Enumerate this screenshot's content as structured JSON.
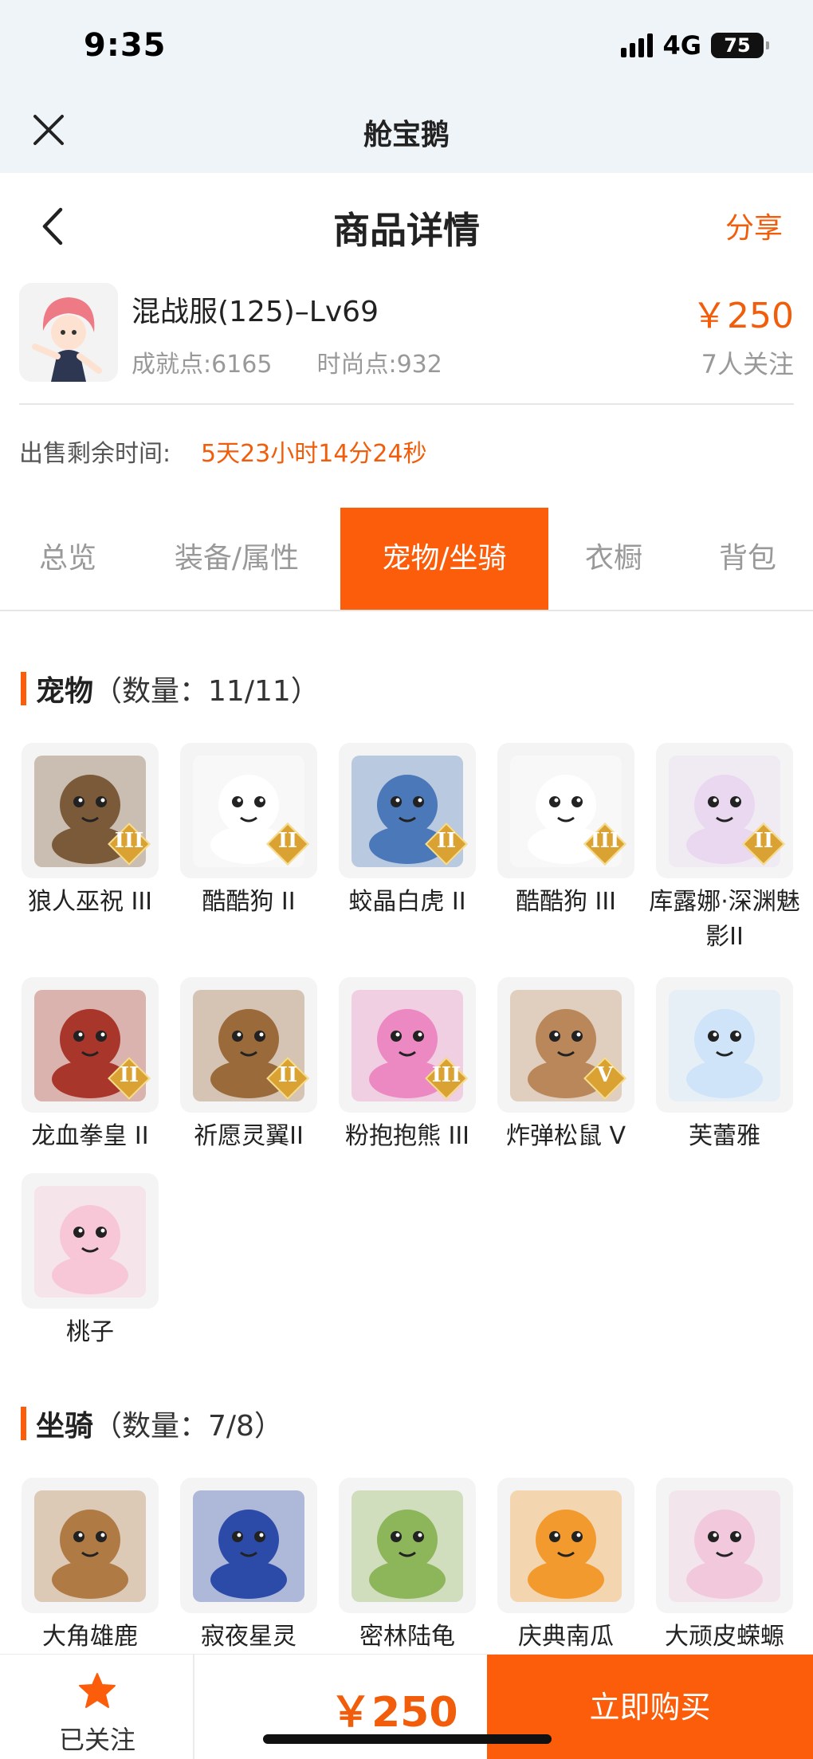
{
  "status_bar": {
    "time": "9:35",
    "network": "4G",
    "battery": "75"
  },
  "mini_app": {
    "title": "舱宝鹅"
  },
  "header": {
    "title": "商品详情",
    "share_label": "分享"
  },
  "product": {
    "name": "混战服(125)–Lv69",
    "achievement": "成就点:6165",
    "fashion": "时尚点:932",
    "price": "￥250",
    "followers": "7人关注"
  },
  "sale_timer": {
    "label": "出售剩余时间:",
    "value": "5天23小时14分24秒"
  },
  "tabs": [
    {
      "label": "总览",
      "active": false
    },
    {
      "label": "装备/属性",
      "active": false
    },
    {
      "label": "宠物/坐骑",
      "active": true
    },
    {
      "label": "衣橱",
      "active": false
    },
    {
      "label": "背包",
      "active": false
    }
  ],
  "pets": {
    "title": "宠物",
    "count": "（数量：11/11）",
    "items": [
      {
        "name": "狼人巫祝 III",
        "rank": "III",
        "icon": "werewolf-pet-icon",
        "color": "#7b5a3a"
      },
      {
        "name": "酷酷狗 II",
        "rank": "II",
        "icon": "goggle-dog-pet-icon",
        "color": "#ffffff"
      },
      {
        "name": "蛟晶白虎 II",
        "rank": "II",
        "icon": "white-tiger-pet-icon",
        "color": "#4a78b8"
      },
      {
        "name": "酷酷狗 III",
        "rank": "III",
        "icon": "goggle-dog-pet-icon",
        "color": "#ffffff"
      },
      {
        "name": "库露娜·深渊魅影II",
        "rank": "II",
        "icon": "kuluna-pet-icon",
        "color": "#e9d8f0"
      },
      {
        "name": "龙血拳皇 II",
        "rank": "II",
        "icon": "dragon-boxer-pet-icon",
        "color": "#a8362a"
      },
      {
        "name": "祈愿灵翼II",
        "rank": "II",
        "icon": "eagle-pet-icon",
        "color": "#9a6a3a"
      },
      {
        "name": "粉抱抱熊 III",
        "rank": "III",
        "icon": "pink-bear-pet-icon",
        "color": "#ec89c3"
      },
      {
        "name": "炸弹松鼠 V",
        "rank": "V",
        "icon": "bomb-squirrel-pet-icon",
        "color": "#b9875a"
      },
      {
        "name": "芙蕾雅",
        "rank": "",
        "icon": "freya-pet-icon",
        "color": "#cfe4f8"
      },
      {
        "name": "桃子",
        "rank": "",
        "icon": "peach-cat-pet-icon",
        "color": "#f7c7d8"
      }
    ]
  },
  "mounts": {
    "title": "坐骑",
    "count": "（数量：7/8）",
    "items": [
      {
        "name": "大角雄鹿",
        "icon": "stag-mount-icon",
        "color": "#b07a45"
      },
      {
        "name": "寂夜星灵",
        "icon": "night-spirit-mount-icon",
        "color": "#2c4aa8"
      },
      {
        "name": "密林陆龟",
        "icon": "turtle-mount-icon",
        "color": "#8db55a"
      },
      {
        "name": "庆典南瓜",
        "icon": "pumpkin-mount-icon",
        "color": "#f29a2e"
      },
      {
        "name": "大顽皮蝾螈",
        "icon": "axolotl-mount-icon",
        "color": "#f2c9dc"
      }
    ]
  },
  "bottom_bar": {
    "follow_label": "已关注",
    "price": "￥250",
    "buy_label": "立即购买"
  },
  "colors": {
    "accent": "#fb5d0a",
    "price": "#f15d0a",
    "muted": "#999999"
  }
}
